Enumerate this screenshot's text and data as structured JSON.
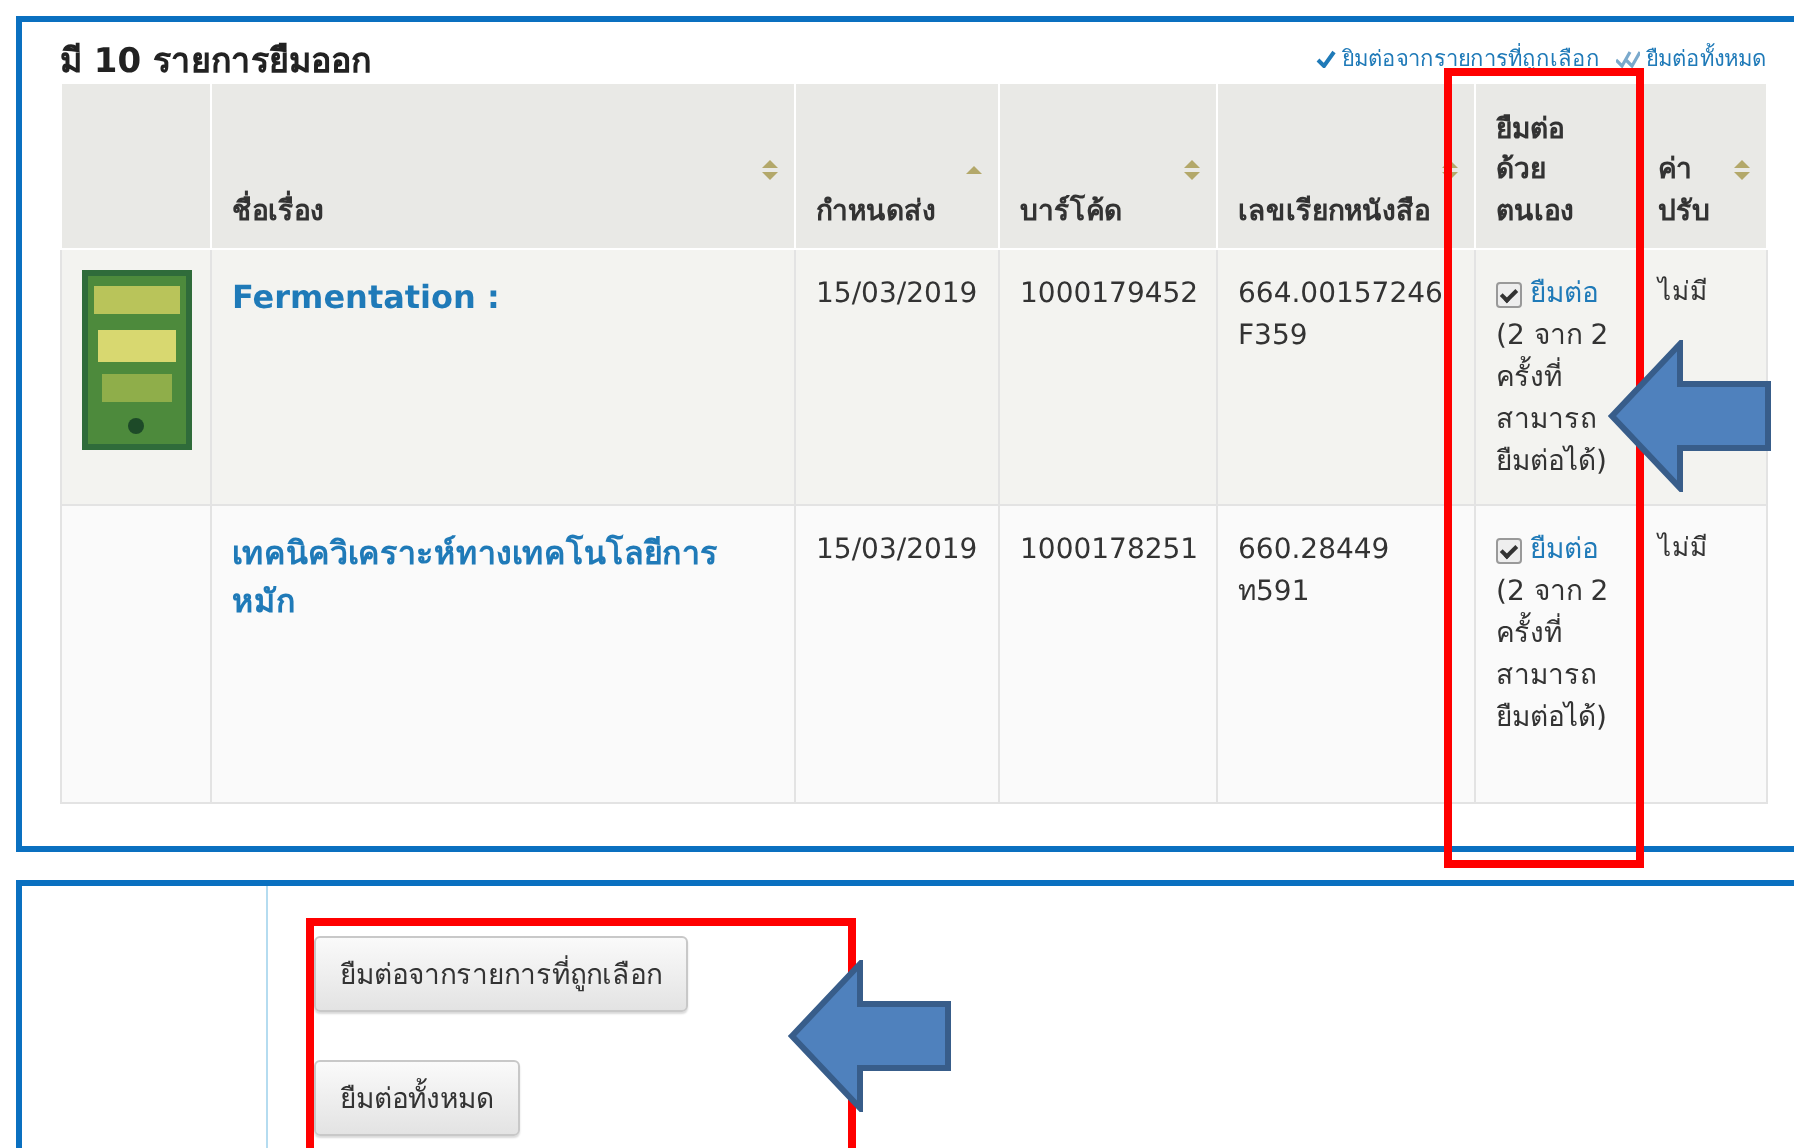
{
  "checkouts": {
    "heading": "มี 10 รายการยืมออก",
    "actions": [
      {
        "label": "ยิมต่อจากรายการที่ถูกเลือก",
        "kind": "check"
      },
      {
        "label": "ยืมต่อทั้งหมด",
        "kind": "double-check"
      }
    ],
    "columns": [
      {
        "label": "ชื่อเรื่อง",
        "sortable": true,
        "sorted": false
      },
      {
        "label": "กำหนดส่ง",
        "sortable": true,
        "sorted": true
      },
      {
        "label": "บาร์โค้ด",
        "sortable": true,
        "sorted": false
      },
      {
        "label": "เลขเรียกหนังสือ",
        "sortable": true,
        "sorted": false
      },
      {
        "label": "ยืมต่อด้วยตนเอง",
        "sortable": false
      },
      {
        "label": "ค่าปรับ",
        "sortable": true,
        "sorted": false
      }
    ],
    "rows": [
      {
        "title": "Fermentation :",
        "due": "15/03/2019",
        "barcode": "1000179452",
        "call_number": [
          "664.00157246",
          "F359"
        ],
        "renew": {
          "checked": true,
          "link": "ยืมต่อ",
          "note": "(2 จาก 2 ครั้งที่สามารถยืมต่อได้)"
        },
        "fine": "ไม่มี"
      },
      {
        "title": "เทคนิควิเคราะห์ทางเทคโนโลยีการหมัก",
        "due": "15/03/2019",
        "barcode": "1000178251",
        "call_number": [
          "660.28449",
          "ท591"
        ],
        "renew": {
          "checked": true,
          "link": "ยืมต่อ",
          "note": "(2 จาก 2 ครั้งที่สามารถยืมต่อได้)"
        },
        "fine": "ไม่มี"
      }
    ]
  },
  "buttons": [
    "ยืมต่อจากรายการที่ถูกเลือก",
    "ยืมต่อทั้งหมด"
  ]
}
